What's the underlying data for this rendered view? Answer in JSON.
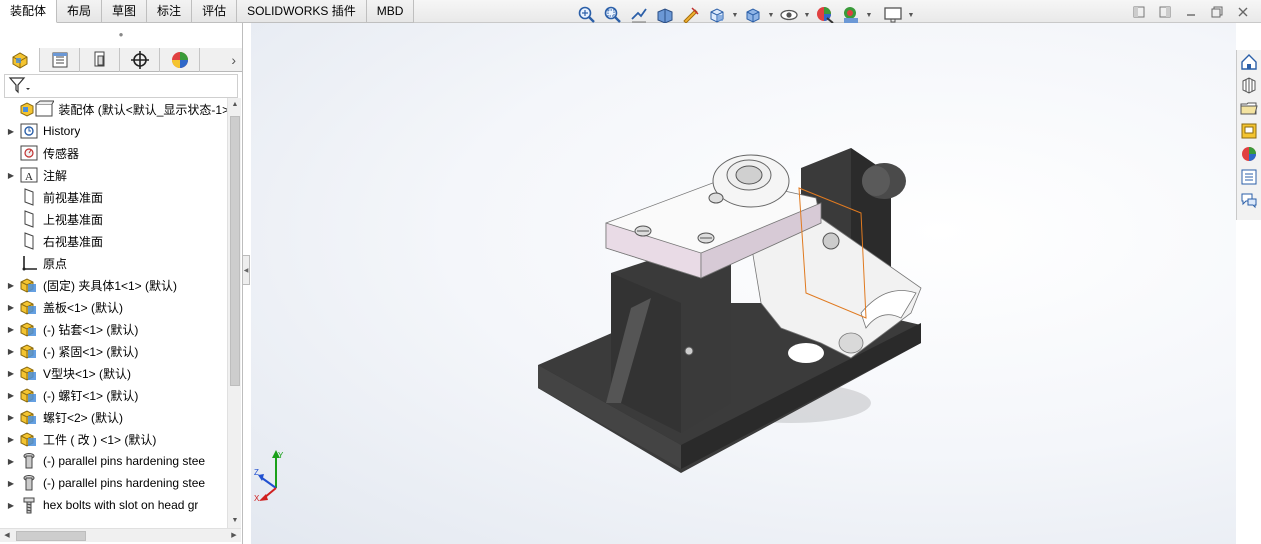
{
  "tabs": [
    {
      "label": "装配体",
      "active": true
    },
    {
      "label": "布局",
      "active": false
    },
    {
      "label": "草图",
      "active": false
    },
    {
      "label": "标注",
      "active": false
    },
    {
      "label": "评估",
      "active": false
    },
    {
      "label": "SOLIDWORKS 插件",
      "active": false
    },
    {
      "label": "MBD",
      "active": false
    }
  ],
  "hud_icons": [
    "zoom-to-fit-icon",
    "zoom-to-area-icon",
    "previous-view-icon",
    "section-view-icon",
    "dynamic-annotation-icon",
    "view-orientation-icon",
    "display-style-icon",
    "hide-show-icon",
    "edit-appearance-icon",
    "apply-scene-icon",
    "view-settings-icon"
  ],
  "manager_tabs": [
    "featuremanager-icon",
    "propertymanager-icon",
    "configurationmanager-icon",
    "dimxpertmanager-icon",
    "displaymanager-icon"
  ],
  "tree": [
    {
      "label": "装配体 (默认<默认_显示状态-1>",
      "icon": "assembly-icon",
      "expander": "",
      "top": true
    },
    {
      "label": "History",
      "icon": "history-icon",
      "expander": "▶"
    },
    {
      "label": "传感器",
      "icon": "sensor-icon",
      "expander": ""
    },
    {
      "label": "注解",
      "icon": "annotation-icon",
      "expander": "▶"
    },
    {
      "label": "前视基准面",
      "icon": "plane-icon",
      "expander": ""
    },
    {
      "label": "上视基准面",
      "icon": "plane-icon",
      "expander": ""
    },
    {
      "label": "右视基准面",
      "icon": "plane-icon",
      "expander": ""
    },
    {
      "label": "原点",
      "icon": "origin-icon",
      "expander": ""
    },
    {
      "label": "(固定) 夹具体1<1> (默认)",
      "icon": "part-icon",
      "expander": "▶"
    },
    {
      "label": "盖板<1> (默认)",
      "icon": "part-icon",
      "expander": "▶"
    },
    {
      "label": "(-) 钻套<1> (默认)",
      "icon": "part-icon",
      "expander": "▶"
    },
    {
      "label": "(-) 紧固<1> (默认)",
      "icon": "part-icon",
      "expander": "▶"
    },
    {
      "label": "V型块<1> (默认)",
      "icon": "part-icon",
      "expander": "▶"
    },
    {
      "label": "(-) 螺钉<1> (默认)",
      "icon": "part-icon",
      "expander": "▶"
    },
    {
      "label": "螺钉<2> (默认)",
      "icon": "part-icon",
      "expander": "▶"
    },
    {
      "label": "工件 ( 改 ) <1> (默认)",
      "icon": "part-icon",
      "expander": "▶"
    },
    {
      "label": "(-) parallel pins hardening stee",
      "icon": "pin-icon",
      "expander": "▶"
    },
    {
      "label": "(-) parallel pins hardening stee",
      "icon": "pin-icon",
      "expander": "▶"
    },
    {
      "label": "hex bolts with slot on head gr",
      "icon": "bolt-icon",
      "expander": "▶"
    }
  ],
  "taskpane_icons": [
    "home-icon",
    "design-library-icon",
    "file-explorer-icon",
    "view-palette-icon",
    "appearances-icon",
    "custom-properties-icon",
    "forum-icon"
  ],
  "triad": {
    "x": "X",
    "y": "Y",
    "z": "Z"
  },
  "colors": {
    "accent": "#1e6fd9",
    "model_dark": "#3a3a3a",
    "model_light": "#f2f2f2"
  }
}
